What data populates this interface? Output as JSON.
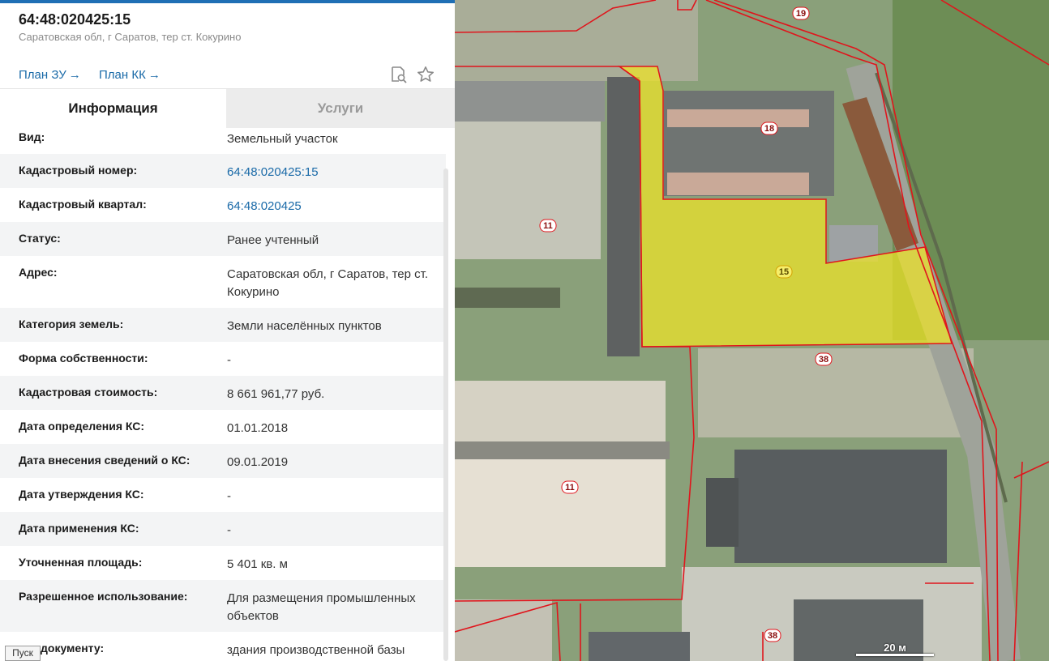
{
  "header": {
    "cadastral_number": "64:48:020425:15",
    "address": "Саратовская обл, г Саратов, тер ст. Кокурино",
    "plan_zu": "План ЗУ",
    "plan_kk": "План КК",
    "arrow": "→"
  },
  "tabs": {
    "info": "Информация",
    "services": "Услуги"
  },
  "rows": [
    {
      "label": "Вид:",
      "value": "Земельный участок"
    },
    {
      "label": "Кадастровый номер:",
      "value": "64:48:020425:15"
    },
    {
      "label": "Кадастровый квартал:",
      "value": "64:48:020425"
    },
    {
      "label": "Статус:",
      "value": "Ранее учтенный"
    },
    {
      "label": "Адрес:",
      "value": "Саратовская обл, г Саратов, тер ст. Кокурино"
    },
    {
      "label": "Категория земель:",
      "value": "Земли населённых пунктов"
    },
    {
      "label": "Форма собственности:",
      "value": "-"
    },
    {
      "label": "Кадастровая стоимость:",
      "value": "8 661 961,77 руб."
    },
    {
      "label": "Дата определения КС:",
      "value": "01.01.2018"
    },
    {
      "label": "Дата внесения сведений о КС:",
      "value": "09.01.2019"
    },
    {
      "label": "Дата утверждения КС:",
      "value": "-"
    },
    {
      "label": "Дата применения КС:",
      "value": "-"
    },
    {
      "label": "Уточненная площадь:",
      "value": "5 401 кв. м"
    },
    {
      "label": "Разрешенное использование:",
      "value": "Для размещения промышленных объектов"
    },
    {
      "label": "документу:",
      "value": "здания производственной базы"
    }
  ],
  "taskbar": {
    "start": "Пуск"
  },
  "map": {
    "labels": [
      "19",
      "18",
      "11",
      "15",
      "38",
      "11",
      "38"
    ],
    "scale": "20 м",
    "colors": {
      "parcel_fill": "#f0e526",
      "boundary": "#e0151c"
    }
  },
  "icons": {
    "doc_search": "document-search-icon",
    "favorite": "star-icon"
  }
}
